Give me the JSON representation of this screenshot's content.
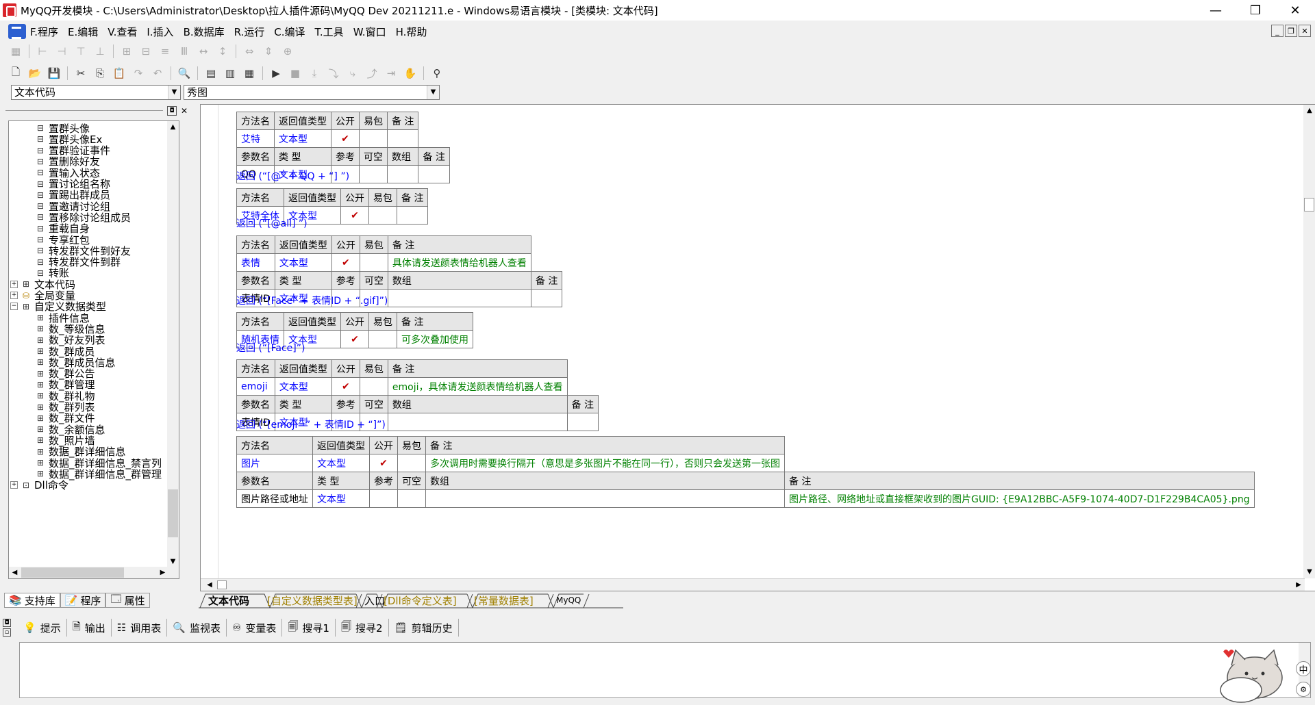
{
  "window": {
    "title": "MyQQ开发模块 - C:\\Users\\Administrator\\Desktop\\拉人插件源码\\MyQQ Dev 20211211.e - Windows易语言模块 - [类模块: 文本代码]",
    "min": "—",
    "restore": "❐",
    "close": "✕"
  },
  "menu": [
    "F.程序",
    "E.编辑",
    "V.查看",
    "I.插入",
    "B.数据库",
    "R.运行",
    "C.编译",
    "T.工具",
    "W.窗口",
    "H.帮助"
  ],
  "combos": {
    "left": "文本代码",
    "right": "秀图"
  },
  "tree": {
    "items": [
      "置群头像",
      "置群头像Ex",
      "置群验证事件",
      "置删除好友",
      "置输入状态",
      "置讨论组名称",
      "置踢出群成员",
      "置邀请讨论组",
      "置移除讨论组成员",
      "重载自身",
      "专享红包",
      "转发群文件到好友",
      "转发群文件到群",
      "转账"
    ],
    "nodes": [
      "文本代码",
      "全局变量",
      "自定义数据类型"
    ],
    "types": [
      "插件信息",
      "数_等级信息",
      "数_好友列表",
      "数_群成员",
      "数_群成员信息",
      "数_群公告",
      "数_群管理",
      "数_群礼物",
      "数_群列表",
      "数_群文件",
      "数_余额信息",
      "数_照片墙",
      "数据_群详细信息",
      "数据_群详细信息_禁言列",
      "数据_群详细信息_群管理"
    ],
    "last": "Dll命令"
  },
  "left_tabs": [
    "支持库",
    "程序",
    "属性"
  ],
  "headers": {
    "method": [
      "方法名",
      "返回值类型",
      "公开",
      "易包",
      "备 注"
    ],
    "param": [
      "参数名",
      "类 型",
      "参考",
      "可空",
      "数组",
      "备 注"
    ]
  },
  "checkmark": "✔",
  "methods": [
    {
      "name": "艾特",
      "type": "文本型",
      "note": "",
      "param": {
        "name": "QQ",
        "type": "文本型"
      },
      "ret": "返回 (“[@” + QQ + “] ”)"
    },
    {
      "name": "艾特全体",
      "type": "文本型",
      "note": "",
      "ret": "返回 (“[@all] ”)"
    },
    {
      "name": "表情",
      "type": "文本型",
      "note": "具体请发送颜表情给机器人查看",
      "param": {
        "name": "表情ID",
        "type": "文本型"
      },
      "ret": "返回 (“[Face” + 表情ID + “.gif]”)"
    },
    {
      "name": "随机表情",
      "type": "文本型",
      "note": "可多次叠加使用",
      "ret": "返回 (“[Face]”)"
    },
    {
      "name": "emoji",
      "type": "文本型",
      "note": "emoji，具体请发送颜表情给机器人查看",
      "param": {
        "name": "表情ID",
        "type": "文本型"
      },
      "ret": "返回 (“[emoji=” + 表情ID + “]”)"
    },
    {
      "name": "图片",
      "type": "文本型",
      "note": "多次调用时需要换行隔开（意思是多张图片不能在同一行），否则只会发送第一张图",
      "param": {
        "name": "图片路径或地址",
        "type": "文本型",
        "note": "图片路径、网络地址或直接框架收到的图片GUID: {E9A12BBC-A5F9-1074-40D7-D1F229B4CA05}.png"
      }
    }
  ],
  "doc_tabs": [
    "文本代码",
    "[自定义数据类型表]",
    "入口",
    "[Dll命令定义表]",
    "[常量数据表]",
    "MyQQ"
  ],
  "output_tabs": [
    "提示",
    "输出",
    "调用表",
    "监视表",
    "变量表",
    "搜寻1",
    "搜寻2",
    "剪辑历史"
  ],
  "ime": "中"
}
